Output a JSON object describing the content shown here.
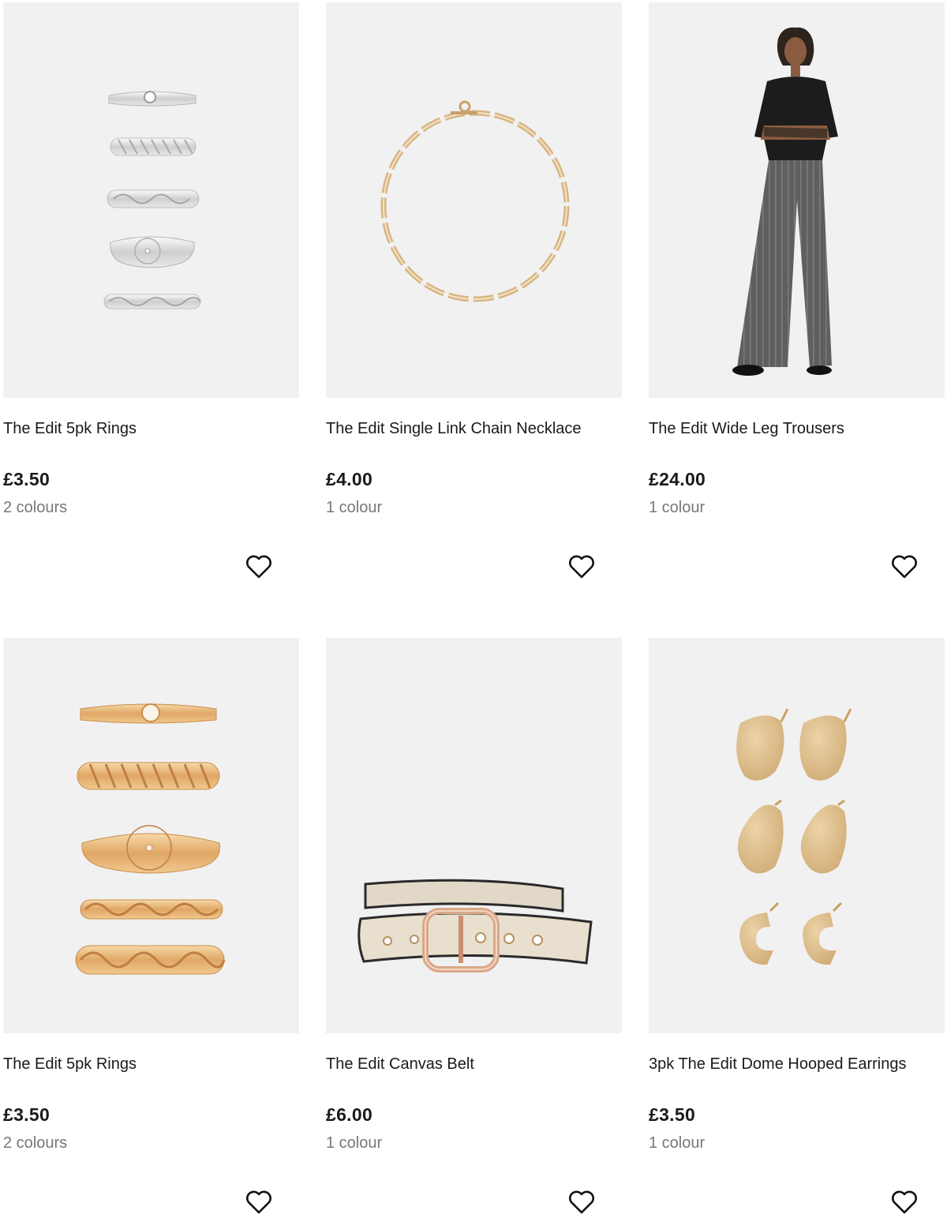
{
  "products": [
    {
      "title": "The Edit 5pk Rings",
      "price": "£3.50",
      "colours": "2 colours",
      "image_icon": "silver-rings-icon"
    },
    {
      "title": "The Edit Single Link Chain Necklace",
      "price": "£4.00",
      "colours": "1 colour",
      "image_icon": "gold-chain-necklace-icon"
    },
    {
      "title": "The Edit Wide Leg Trousers",
      "price": "£24.00",
      "colours": "1 colour",
      "image_icon": "model-wide-leg-trousers-icon"
    },
    {
      "title": "The Edit 5pk Rings",
      "price": "£3.50",
      "colours": "2 colours",
      "image_icon": "gold-rings-icon"
    },
    {
      "title": "The Edit Canvas Belt",
      "price": "£6.00",
      "colours": "1 colour",
      "image_icon": "canvas-belt-icon"
    },
    {
      "title": "3pk The Edit Dome Hooped Earrings",
      "price": "£3.50",
      "colours": "1 colour",
      "image_icon": "gold-earrings-icon"
    }
  ],
  "wishlist_icon": "heart-outline-icon",
  "colors": {
    "image_bg": "#f1f1f1",
    "text": "#1a1a1a",
    "muted": "#777777"
  }
}
